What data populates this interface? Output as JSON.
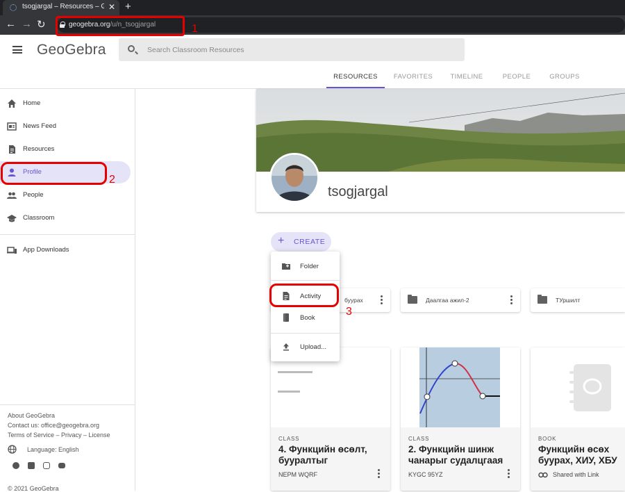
{
  "browser": {
    "tab_title": "tsogjargal – Resources – GeoGebra",
    "tab_close": "✕",
    "new_tab": "+",
    "url_domain": "geogebra.org",
    "url_path": "/u/n_tsogjargal"
  },
  "annotations": {
    "n1": "1",
    "n2": "2",
    "n3": "3"
  },
  "header": {
    "logo": "GeoGebra",
    "search_placeholder": "Search Classroom Resources",
    "tabs": [
      "RESOURCES",
      "FAVORITES",
      "TIMELINE",
      "PEOPLE",
      "GROUPS"
    ],
    "active_tab": "RESOURCES"
  },
  "sidebar": {
    "items": [
      {
        "label": "Home",
        "icon": "home-icon"
      },
      {
        "label": "News Feed",
        "icon": "newsfeed-icon"
      },
      {
        "label": "Resources",
        "icon": "document-icon"
      },
      {
        "label": "Profile",
        "icon": "person-icon"
      },
      {
        "label": "People",
        "icon": "people-icon"
      },
      {
        "label": "Classroom",
        "icon": "graduation-cap-icon"
      }
    ],
    "downloads": "App Downloads",
    "footer": {
      "about": "About GeoGebra",
      "contact": "Contact us: office@geogebra.org",
      "terms": "Terms of Service – Privacy – License",
      "language": "Language: English",
      "copyright": "© 2021 GeoGebra"
    }
  },
  "profile": {
    "username": "tsogjargal"
  },
  "create_button": "CREATE",
  "create_menu": [
    "Folder",
    "Activity",
    "Book",
    "Upload..."
  ],
  "folders": [
    "буурах",
    "Даалгаа ажил-2",
    "ТУршилт"
  ],
  "cards": [
    {
      "type": "CLASS",
      "title": "4. Функцийн өсөлт, буурaлтыг",
      "code": "NEPM WQRF"
    },
    {
      "type": "CLASS",
      "title": "2. Функцийн шинж чанарыг судалцгаая",
      "code": "KYGC 95YZ"
    },
    {
      "type": "BOOK",
      "title": "Функцийн өсөх буурах, ХИУ, ХБУ",
      "code": "Shared with Link"
    }
  ],
  "colors": {
    "accent": "#6557d2",
    "annotation": "#e60000"
  }
}
